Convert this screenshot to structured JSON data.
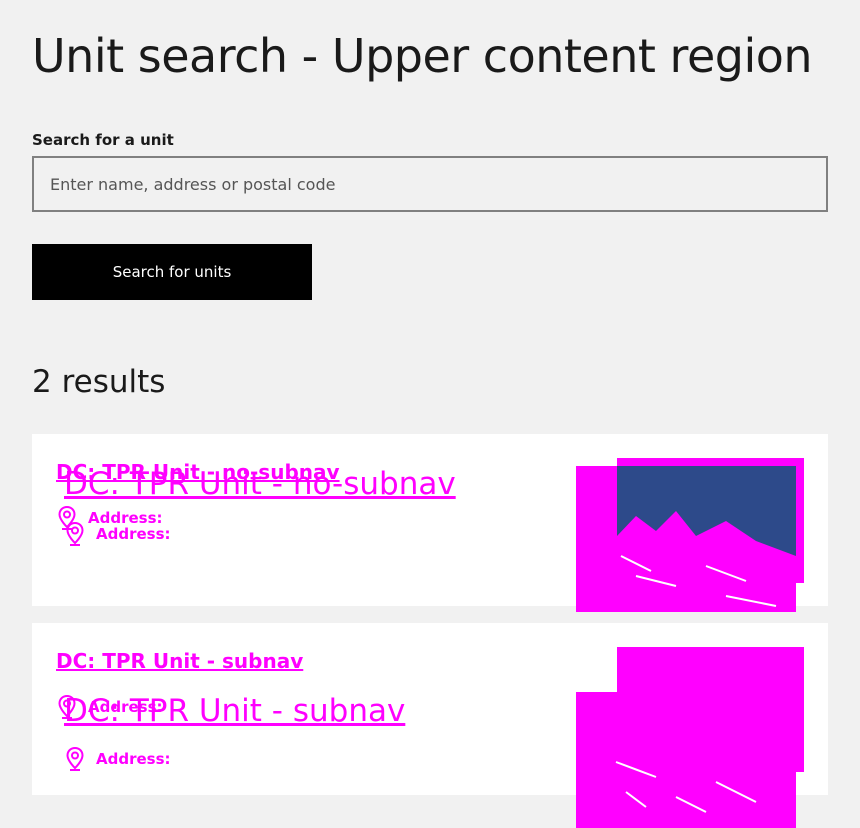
{
  "page": {
    "title": "Unit search - Upper content region"
  },
  "search": {
    "label": "Search for a unit",
    "placeholder": "Enter name, address or postal code",
    "value": "",
    "button_label": "Search for units"
  },
  "results": {
    "count_text": "2 results",
    "items": [
      {
        "title": "DC: TPR Unit - no-subnav",
        "title_duplicate": "DC: TPR Unit - no-subnav",
        "address_label": "Address:",
        "address_label_duplicate": "Address:"
      },
      {
        "title": "DC: TPR Unit - subnav",
        "title_duplicate": "DC: TPR Unit - subnav",
        "address_label": "Address:",
        "address_label_duplicate": "Address:"
      }
    ]
  },
  "colors": {
    "background": "#f1f1f1",
    "accent": "#ff00ff",
    "button": "#000000",
    "card": "#ffffff"
  },
  "icons": {
    "address": "location-pin-icon"
  }
}
